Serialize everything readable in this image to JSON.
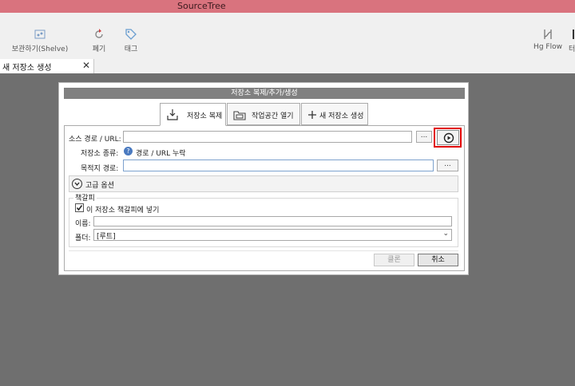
{
  "window": {
    "title": "SourceTree"
  },
  "toolbar": {
    "shelve": {
      "label": "보관하기(Shelve)",
      "icon": "shelve-icon"
    },
    "discard": {
      "label": "폐기",
      "icon": "discard-icon"
    },
    "tag": {
      "label": "태그",
      "icon": "tag-icon"
    },
    "hgflow": {
      "label": "Hg Flow",
      "icon": "hg-flow-icon"
    },
    "partial": {
      "label": "터"
    }
  },
  "tab": {
    "label": "새 저장소 생성",
    "close": "✕"
  },
  "dialog": {
    "title": "저장소 복제/추가/생성",
    "tabs": [
      {
        "label": "저장소 복제",
        "icon": "clone-download-icon"
      },
      {
        "label": "작업공간 열기",
        "icon": "folder-icon"
      },
      {
        "label": "새 저장소 생성",
        "icon": "plus-icon"
      }
    ],
    "source_label": "소스 경로 / URL:",
    "source_value": "",
    "browse": "...",
    "repo_type_label": "저장소 종류:",
    "repo_type_value": "경로 / URL 누락",
    "dest_label": "목적지 경로:",
    "dest_value": "",
    "advanced_label": "고급 옵션",
    "bookmark_section": "책갈피",
    "bookmark_checkbox": "이 저장소 책갈피에 넣기",
    "bookmark_checked": true,
    "name_label": "이름:",
    "name_value": "",
    "folder_label": "폴더:",
    "folder_value": "[루트]",
    "clone_button": "클론",
    "cancel_button": "취소"
  }
}
